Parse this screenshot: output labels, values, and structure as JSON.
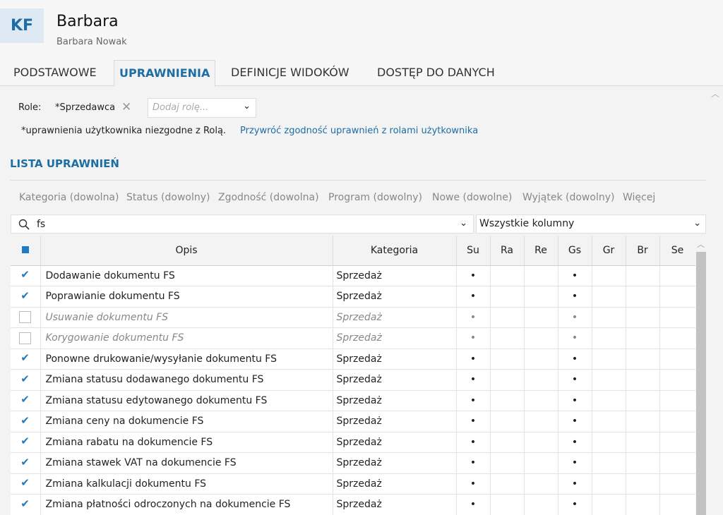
{
  "header": {
    "initials": "KF",
    "name": "Barbara",
    "full_name": "Barbara Nowak"
  },
  "tabs": [
    {
      "label": "PODSTAWOWE",
      "active": false
    },
    {
      "label": "UPRAWNIENIA",
      "active": true
    },
    {
      "label": "DEFINICJE WIDOKÓW",
      "active": false
    },
    {
      "label": "DOSTĘP DO DANYCH",
      "active": false
    }
  ],
  "roles": {
    "label": "Role:",
    "current": "*Sprzedawca",
    "add_placeholder": "Dodaj rolę...",
    "note": "*uprawnienia użytkownika niezgodne z Rolą.",
    "restore_link": "Przywróć zgodność uprawnień z rolami użytkownika"
  },
  "section_title": "LISTA UPRAWNIEŃ",
  "filters": [
    "Kategoria (dowolna)",
    "Status (dowolny)",
    "Zgodność (dowolna)",
    "Program (dowolny)",
    "Nowe (dowolne)",
    "Wyjątek (dowolny)",
    "Więcej"
  ],
  "search": {
    "value": "fs",
    "columns_select": "Wszystkie kolumny"
  },
  "table": {
    "columns": [
      "Opis",
      "Kategoria",
      "Su",
      "Ra",
      "Re",
      "Gs",
      "Gr",
      "Br",
      "Se"
    ],
    "dot_symbol": "•",
    "rows": [
      {
        "opis": "Dodawanie dokumentu FS",
        "kategoria": "Sprzedaż",
        "checked": true,
        "su": "•",
        "gs": "•"
      },
      {
        "opis": "Poprawianie dokumentu FS",
        "kategoria": "Sprzedaż",
        "checked": true,
        "su": "•",
        "gs": "•"
      },
      {
        "opis": "Usuwanie dokumentu FS",
        "kategoria": "Sprzedaż",
        "checked": false,
        "su": "•",
        "gs": "•"
      },
      {
        "opis": "Korygowanie dokumentu FS",
        "kategoria": "Sprzedaż",
        "checked": false,
        "su": "•",
        "gs": "•"
      },
      {
        "opis": "Ponowne drukowanie/wysyłanie dokumentu FS",
        "kategoria": "Sprzedaż",
        "checked": true,
        "su": "•",
        "gs": "•"
      },
      {
        "opis": "Zmiana statusu dodawanego dokumentu FS",
        "kategoria": "Sprzedaż",
        "checked": true,
        "su": "•",
        "gs": "•"
      },
      {
        "opis": "Zmiana statusu edytowanego dokumentu FS",
        "kategoria": "Sprzedaż",
        "checked": true,
        "su": "•",
        "gs": "•"
      },
      {
        "opis": "Zmiana ceny na dokumencie FS",
        "kategoria": "Sprzedaż",
        "checked": true,
        "su": "•",
        "gs": "•"
      },
      {
        "opis": "Zmiana rabatu na dokumencie FS",
        "kategoria": "Sprzedaż",
        "checked": true,
        "su": "•",
        "gs": "•"
      },
      {
        "opis": "Zmiana stawek VAT na dokumencie FS",
        "kategoria": "Sprzedaż",
        "checked": true,
        "su": "•",
        "gs": "•"
      },
      {
        "opis": "Zmiana kalkulacji dokumentu FS",
        "kategoria": "Sprzedaż",
        "checked": true,
        "su": "•",
        "gs": "•"
      },
      {
        "opis": "Zmiana płatności odroczonych na dokumencie FS",
        "kategoria": "Sprzedaż",
        "checked": true,
        "su": "•",
        "gs": "•"
      }
    ]
  }
}
